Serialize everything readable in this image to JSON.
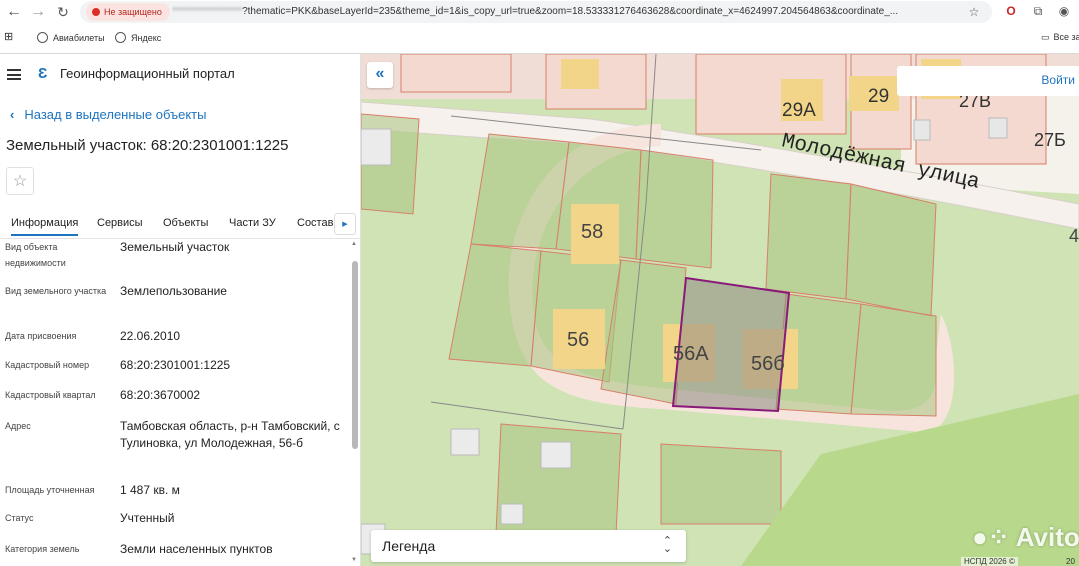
{
  "browser": {
    "not_secure": "Не защищено",
    "url_host": "******************",
    "url_rest": "?thematic=PKK&baseLayerId=235&theme_id=1&is_copy_url=true&zoom=18.533331276463628&coordinate_x=4624997.204564863&coordinate_...",
    "bookmarks": [
      {
        "label": "Авиабилеты"
      },
      {
        "label": "Яндекс"
      }
    ],
    "all_bookmarks": "Все за"
  },
  "portal": {
    "title": "Геоинформационный портал"
  },
  "panel": {
    "back_label": "Назад в выделенные объекты",
    "object_title": "Земельный участок: 68:20:2301001:1225",
    "tabs": [
      {
        "label": "Информация"
      },
      {
        "label": "Сервисы"
      },
      {
        "label": "Объекты"
      },
      {
        "label": "Части ЗУ"
      },
      {
        "label": "Состав"
      }
    ],
    "rows": [
      {
        "label": "Вид объекта недвижимости",
        "value": "Земельный участок"
      },
      {
        "label": "Вид земельного участка",
        "value": "Землепользование"
      },
      {
        "label": "Дата присвоения",
        "value": "22.06.2010"
      },
      {
        "label": "Кадастровый номер",
        "value": "68:20:2301001:1225"
      },
      {
        "label": "Кадастровый квартал",
        "value": "68:20:3670002"
      },
      {
        "label": "Адрес",
        "value": "Тамбовская область, р-н Тамбовский, с Тулиновка, ул Молодежная, 56-б"
      },
      {
        "label": "Площадь уточненная",
        "value": "1 487 кв. м"
      },
      {
        "label": "Статус",
        "value": "Учтенный"
      },
      {
        "label": "Категория земель",
        "value": "Земли населенных пунктов"
      }
    ]
  },
  "map": {
    "login_label": "Войти",
    "street_label": "Молодёжная улица",
    "house_labels": {
      "h29a": "29А",
      "h29": "29",
      "h27v": "27В",
      "h27b": "27Б",
      "h58": "58",
      "h56": "56",
      "h56a": "56А",
      "h56b": "56б",
      "h4": "4"
    },
    "legend_label": "Легенда",
    "watermark": "Avito",
    "copyright": "НСПД 2026 ©",
    "zoom_text": "20"
  },
  "colors": {
    "link": "#1e73be",
    "parcel_fill": "#b7c98a",
    "parcel_stroke": "#d77f6a",
    "selected_stroke": "#8a1a7a",
    "building": "#f3d58a",
    "road": "#f6e6e0"
  }
}
